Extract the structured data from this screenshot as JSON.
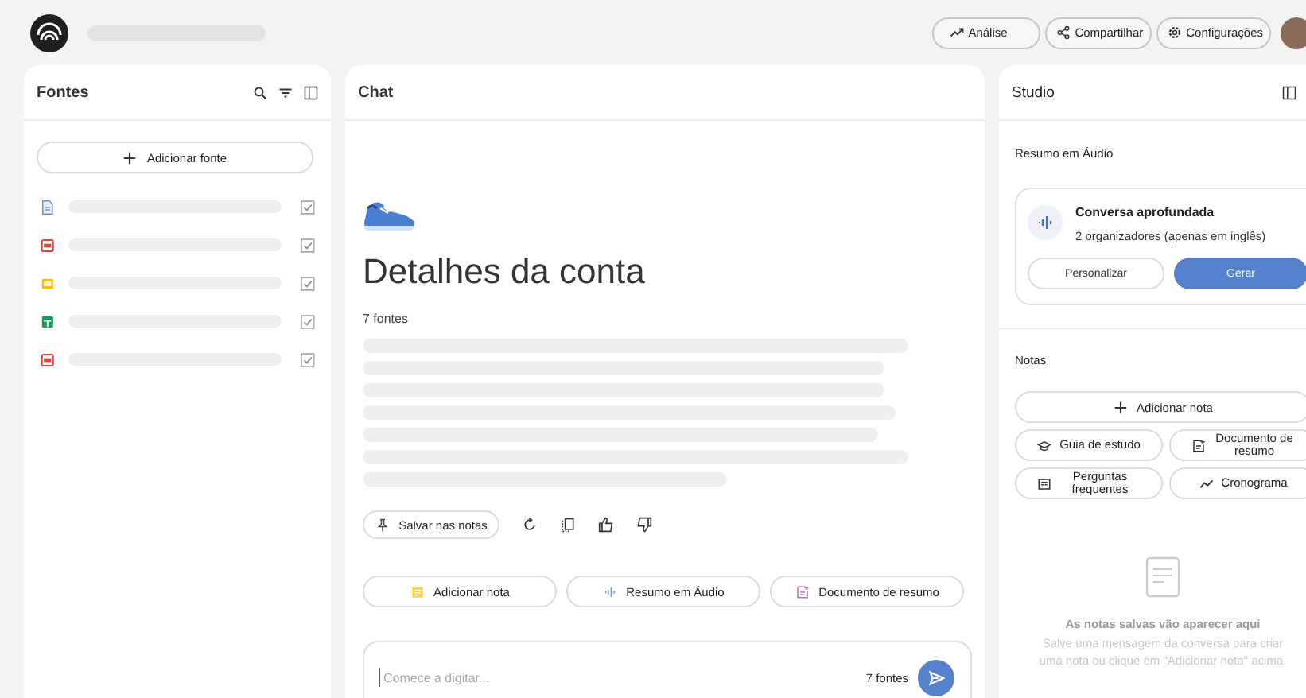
{
  "header": {
    "buttons": [
      {
        "label": "Análise",
        "kind": "chart"
      },
      {
        "label": "Compartilhar",
        "kind": "share"
      },
      {
        "label": "Configurações",
        "kind": "gear"
      }
    ]
  },
  "sources": {
    "title": "Fontes",
    "add_button": "Adicionar fonte",
    "items": [
      {
        "kind": "doc",
        "checked": true
      },
      {
        "kind": "pdf",
        "checked": true
      },
      {
        "kind": "slides",
        "checked": true
      },
      {
        "kind": "sheet",
        "checked": true
      },
      {
        "kind": "pdf",
        "checked": true
      }
    ]
  },
  "chat": {
    "title": "Chat",
    "heading": "Detalhes da conta",
    "source_count": "7 fontes",
    "save_button": "Salvar nas notas",
    "actions": [
      {
        "label": "Adicionar nota",
        "kind": "note"
      },
      {
        "label": "Resumo em Áudio",
        "kind": "audio"
      },
      {
        "label": "Documento de resumo",
        "kind": "doc"
      }
    ],
    "input": {
      "placeholder": "Comece a digitar...",
      "source_count": "7 fontes"
    }
  },
  "studio": {
    "title": "Studio",
    "audio_section": "Resumo em Áudio",
    "audio_card": {
      "title": "Conversa aprofundada",
      "subtitle": "2 organizadores (apenas em inglês)",
      "buttons": [
        {
          "label": "Personalizar",
          "kind": "outline"
        },
        {
          "label": "Gerar",
          "kind": "primary"
        }
      ]
    },
    "notes_section": "Notas",
    "add_note": "Adicionar nota",
    "note_buttons": [
      {
        "label": "Guia de estudo",
        "kind": "cap"
      },
      {
        "label": "Documento de resumo",
        "kind": "doc"
      },
      {
        "label": "Perguntas frequentes",
        "kind": "faq"
      },
      {
        "label": "Cronograma",
        "kind": "timeline"
      }
    ],
    "empty": {
      "title": "As notas salvas vão aparecer aqui",
      "text": "Salve uma mensagem da conversa para criar uma nota ou clique em \"Adicionar nota\" acima."
    }
  }
}
